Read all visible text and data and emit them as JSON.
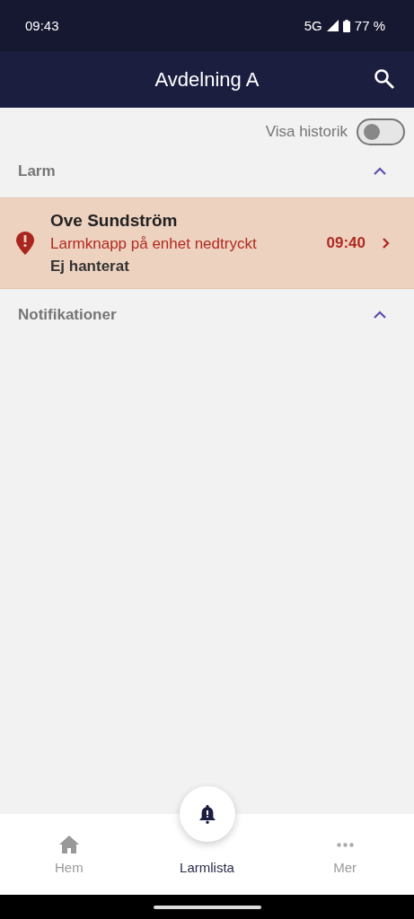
{
  "status_bar": {
    "time": "09:43",
    "network": "5G",
    "battery": "77 %"
  },
  "app_bar": {
    "title": "Avdelning A"
  },
  "history_toggle": {
    "label": "Visa historik",
    "on": false
  },
  "sections": [
    {
      "title": "Larm",
      "expanded": true,
      "items": [
        {
          "name": "Ove Sundström",
          "message": "Larmknapp på enhet nedtryckt",
          "status": "Ej hanterat",
          "time": "09:40"
        }
      ]
    },
    {
      "title": "Notifikationer",
      "expanded": true
    }
  ],
  "bottom_nav": [
    {
      "kind": "home",
      "label": "Hem",
      "selected": false
    },
    {
      "kind": "alarm",
      "label": "Larmlista",
      "selected": true
    },
    {
      "kind": "more",
      "label": "Mer",
      "selected": false
    }
  ]
}
